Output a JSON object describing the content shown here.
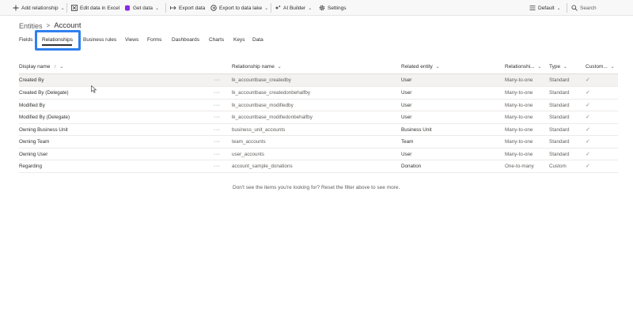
{
  "toolbar": {
    "add_relationship": "Add relationship",
    "edit_in_excel": "Edit data in Excel",
    "get_data": "Get data",
    "export_data": "Export data",
    "export_to_data_lake": "Export to data lake",
    "ai_builder": "AI Builder",
    "settings": "Settings",
    "view_selector": "Default",
    "search_placeholder": "Search"
  },
  "breadcrumb": {
    "parent": "Entities",
    "separator": ">",
    "current": "Account"
  },
  "tabs": [
    "Fields",
    "Relationships",
    "Business rules",
    "Views",
    "Forms",
    "Dashboards",
    "Charts",
    "Keys",
    "Data"
  ],
  "active_tab": "Relationships",
  "table": {
    "columns": {
      "display_name": "Display name",
      "sort_indicator": "↑",
      "relationship_name": "Relationship name",
      "related_entity": "Related entity",
      "relationship_type": "Relationshi...",
      "type": "Type",
      "custom": "Custom..."
    },
    "more_label": "···",
    "check_glyph": "✓",
    "rows": [
      {
        "display_name": "Created By",
        "relationship_name": "lk_accountbase_createdby",
        "related_entity": "User",
        "relationship_type": "Many-to-one",
        "type": "Standard"
      },
      {
        "display_name": "Created By (Delegate)",
        "relationship_name": "lk_accountbase_createdonbehalfby",
        "related_entity": "User",
        "relationship_type": "Many-to-one",
        "type": "Standard"
      },
      {
        "display_name": "Modified By",
        "relationship_name": "lk_accountbase_modifiedby",
        "related_entity": "User",
        "relationship_type": "Many-to-one",
        "type": "Standard"
      },
      {
        "display_name": "Modified By (Delegate)",
        "relationship_name": "lk_accountbase_modifiedonbehalfby",
        "related_entity": "User",
        "relationship_type": "Many-to-one",
        "type": "Standard"
      },
      {
        "display_name": "Owning Business Unit",
        "relationship_name": "business_unit_accounts",
        "related_entity": "Business Unit",
        "relationship_type": "Many-to-one",
        "type": "Standard"
      },
      {
        "display_name": "Owning Team",
        "relationship_name": "team_accounts",
        "related_entity": "Team",
        "relationship_type": "Many-to-one",
        "type": "Standard"
      },
      {
        "display_name": "Owning User",
        "relationship_name": "user_accounts",
        "related_entity": "User",
        "relationship_type": "Many-to-one",
        "type": "Standard"
      },
      {
        "display_name": "Regarding",
        "relationship_name": "account_sample_donations",
        "related_entity": "Donation",
        "relationship_type": "One-to-many",
        "type": "Custom"
      }
    ]
  },
  "footer_message": "Don't see the items you're looking for? Reset the filter above to see more.",
  "colors": {
    "highlight": "#2f80ed",
    "toolbar_bg": "#f8f8f8",
    "selected_row": "#f3f2f1"
  }
}
